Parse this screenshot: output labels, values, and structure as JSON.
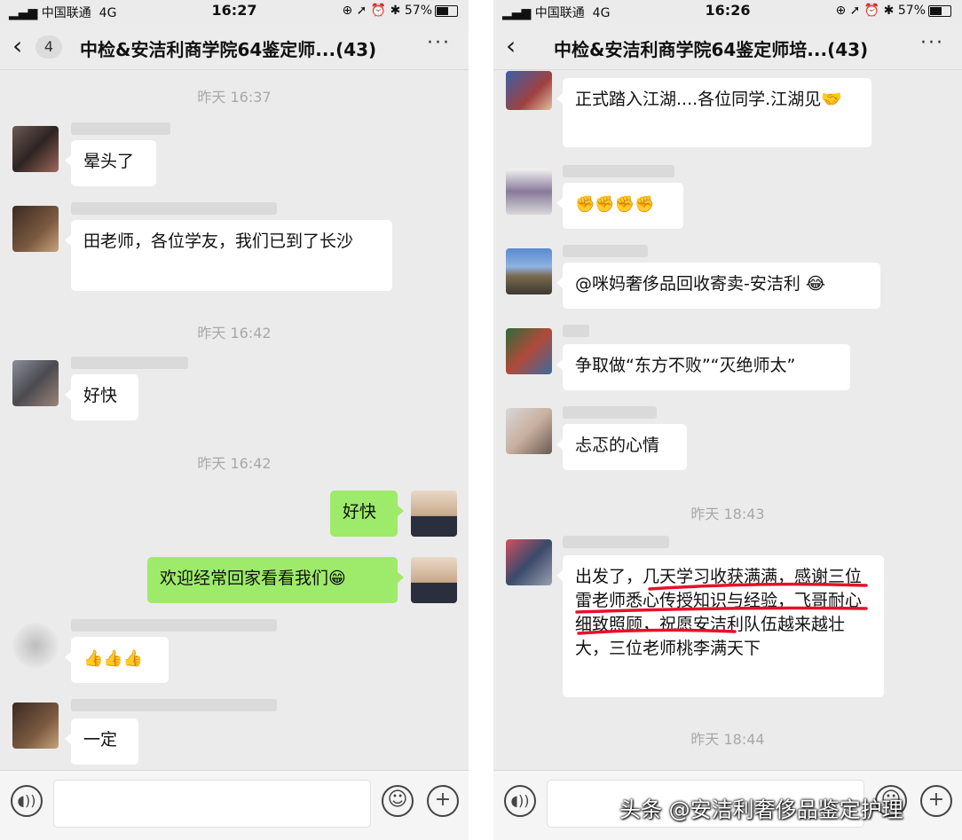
{
  "left": {
    "status": {
      "carrier": "中国联通",
      "network": "4G",
      "time": "16:27",
      "icons": "⊕ ➚ ⏰ ✱",
      "battery": "57%",
      "battery_level": 0.57
    },
    "nav": {
      "back_badge": "4",
      "title": "中检&安洁利商学院64鉴定师...(43)",
      "more": "···"
    },
    "messages": [
      {
        "type": "time",
        "text": "昨天 16:37"
      },
      {
        "type": "other",
        "text": "晕头了"
      },
      {
        "type": "other",
        "text": "田老师，各位学友，我们已到了长沙"
      },
      {
        "type": "time",
        "text": "昨天 16:42"
      },
      {
        "type": "other",
        "text": "好快"
      },
      {
        "type": "time",
        "text": "昨天 16:42"
      },
      {
        "type": "me",
        "text": "好快"
      },
      {
        "type": "me",
        "text": "欢迎经常回家看看我们😁"
      },
      {
        "type": "other",
        "text": "👍👍👍"
      },
      {
        "type": "other",
        "text": "一定"
      }
    ]
  },
  "right": {
    "status": {
      "carrier": "中国联通",
      "network": "4G",
      "time": "16:26",
      "icons": "⊕ ➚ ⏰ ✱",
      "battery": "57%",
      "battery_level": 0.57
    },
    "nav": {
      "title": "中检&安洁利商学院64鉴定师培...(43)",
      "more": "···"
    },
    "messages": [
      {
        "type": "other",
        "text": "正式踏入江湖....各位同学.江湖见🤝"
      },
      {
        "type": "other",
        "text": "✊✊✊✊"
      },
      {
        "type": "other",
        "text": "@咪妈奢侈品回收寄卖-安洁利 😂"
      },
      {
        "type": "other",
        "text": "争取做“东方不败”“灭绝师太”"
      },
      {
        "type": "other",
        "text": "忐忑的心情"
      },
      {
        "type": "time",
        "text": "昨天 18:43"
      },
      {
        "type": "other",
        "text": "出发了，几天学习收获满满，感谢三位雷老师悉心传授知识与经验，飞哥耐心细致照顾，祝愿安洁利队伍越来越壮大，三位老师桃李满天下"
      },
      {
        "type": "time",
        "text": "昨天 18:44"
      }
    ]
  },
  "input": {
    "voice_icon": "voice-icon",
    "emoji_icon": "emoji-icon",
    "plus_icon": "plus-icon"
  },
  "watermark": "头条 @安洁利奢侈品鉴定护理",
  "colors": {
    "bubble_me": "#9eea6a",
    "bubble_other": "#ffffff",
    "chat_bg": "#ebebeb",
    "underline": "#e8102a"
  }
}
